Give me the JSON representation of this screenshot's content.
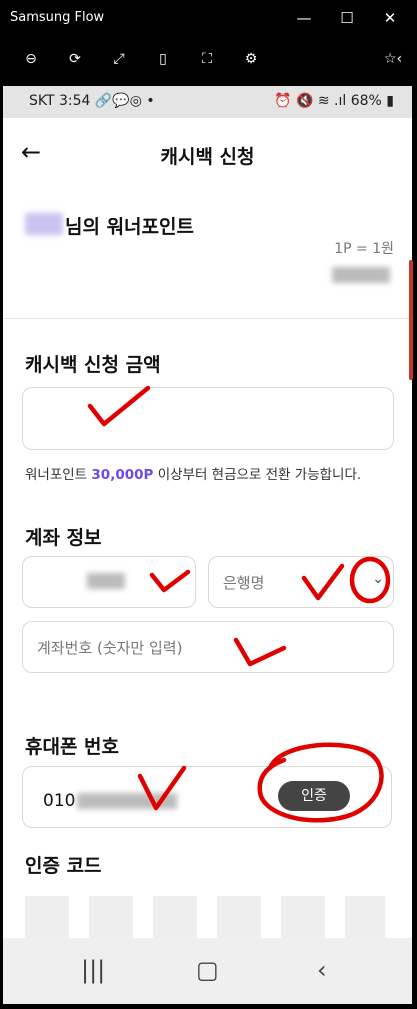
{
  "window": {
    "title": "Samsung Flow"
  },
  "status_bar": {
    "carrier": "SKT",
    "time": "3:54",
    "battery": "68%"
  },
  "header": {
    "title": "캐시백 신청"
  },
  "points": {
    "owner_suffix": "님의 워너포인트",
    "rate": "1P = 1원"
  },
  "cashback": {
    "title": "캐시백 신청 금액",
    "info_prefix": "워너포인트 ",
    "info_amount": "30,000P",
    "info_suffix": " 이상부터 현금으로 전환 가능합니다."
  },
  "account": {
    "title": "계좌 정보",
    "bank_placeholder": "은행명",
    "number_placeholder": "계좌번호 (숫자만 입력)"
  },
  "phone": {
    "title": "휴대폰 번호",
    "prefix": "010",
    "verify_label": "인증"
  },
  "code": {
    "title": "인증 코드"
  },
  "colors": {
    "accent": "#6b4ce6",
    "annotation_red": "#e00000"
  }
}
